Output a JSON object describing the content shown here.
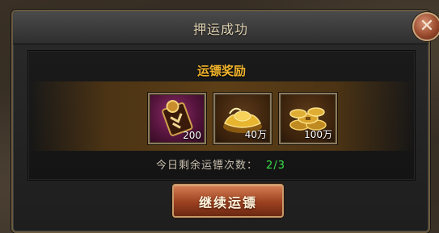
{
  "dialog": {
    "title": "押运成功",
    "close_icon": "close-icon"
  },
  "rewards": {
    "section_title": "运镖奖励",
    "items": [
      {
        "icon": "token-badge-icon",
        "quantity": "200"
      },
      {
        "icon": "gold-ingot-icon",
        "quantity": "40万"
      },
      {
        "icon": "gold-coins-icon",
        "quantity": "100万"
      }
    ]
  },
  "status": {
    "remaining_label": "今日剩余运镖次数：",
    "remaining_count": "2/3"
  },
  "actions": {
    "continue_label": "继续运镖"
  },
  "colors": {
    "section_title": "#f0b32c",
    "remaining_count": "#3be14a",
    "button": "#9c4120"
  }
}
